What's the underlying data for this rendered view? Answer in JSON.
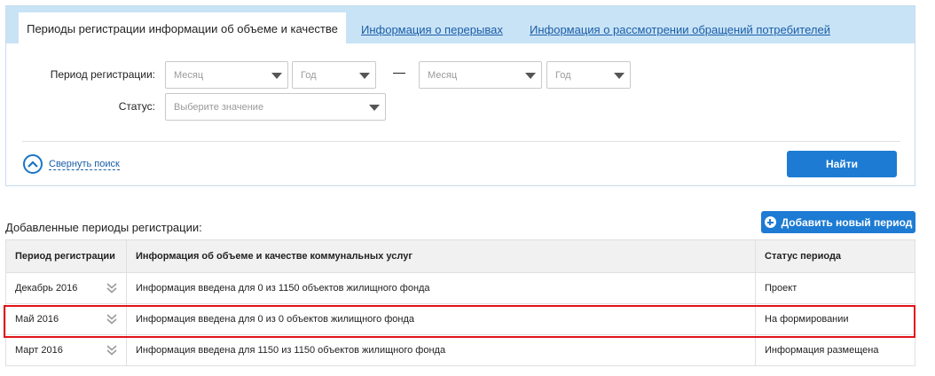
{
  "tabs": {
    "active": "Периоды регистрации информации об объеме и качестве",
    "link1": "Информация о перерывах",
    "link2": "Информация о рассмотрении обращений потребителей"
  },
  "search": {
    "period_label": "Период регистрации:",
    "month_from_placeholder": "Месяц",
    "year_from_placeholder": "Год",
    "month_to_placeholder": "Месяц",
    "year_to_placeholder": "Год",
    "status_label": "Статус:",
    "status_placeholder": "Выберите значение",
    "collapse_label": "Свернуть поиск",
    "find_label": "Найти"
  },
  "section": {
    "title": "Добавленные периоды регистрации:",
    "add_label": "Добавить новый период"
  },
  "table": {
    "headers": [
      "Период регистрации",
      "Информация об объеме и качестве коммунальных услуг",
      "Статус периода"
    ],
    "rows": [
      {
        "period": "Декабрь 2016",
        "info": "Информация введена для 0 из 1150 объектов жилищного фонда",
        "status": "Проект"
      },
      {
        "period": "Май 2016",
        "info": "Информация введена для 0 из 0 объектов жилищного фонда",
        "status": "На формировании"
      },
      {
        "period": "Март 2016",
        "info": "Информация введена для 1150 из 1150 объектов жилищного фонда",
        "status": "Информация размещена"
      }
    ]
  },
  "colors": {
    "accent": "#1d7bd3",
    "tabbar": "#c9e3f6",
    "highlight": "#e0141b"
  }
}
